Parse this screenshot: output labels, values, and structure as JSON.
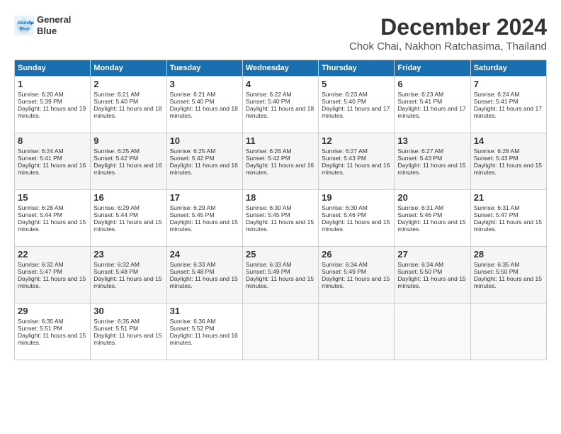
{
  "header": {
    "logo_line1": "General",
    "logo_line2": "Blue",
    "month": "December 2024",
    "location": "Chok Chai, Nakhon Ratchasima, Thailand"
  },
  "weekdays": [
    "Sunday",
    "Monday",
    "Tuesday",
    "Wednesday",
    "Thursday",
    "Friday",
    "Saturday"
  ],
  "weeks": [
    [
      {
        "day": "1",
        "sunrise": "6:20 AM",
        "sunset": "5:39 PM",
        "daylight": "11 hours and 19 minutes."
      },
      {
        "day": "2",
        "sunrise": "6:21 AM",
        "sunset": "5:40 PM",
        "daylight": "11 hours and 18 minutes."
      },
      {
        "day": "3",
        "sunrise": "6:21 AM",
        "sunset": "5:40 PM",
        "daylight": "11 hours and 18 minutes."
      },
      {
        "day": "4",
        "sunrise": "6:22 AM",
        "sunset": "5:40 PM",
        "daylight": "11 hours and 18 minutes."
      },
      {
        "day": "5",
        "sunrise": "6:23 AM",
        "sunset": "5:40 PM",
        "daylight": "11 hours and 17 minutes."
      },
      {
        "day": "6",
        "sunrise": "6:23 AM",
        "sunset": "5:41 PM",
        "daylight": "11 hours and 17 minutes."
      },
      {
        "day": "7",
        "sunrise": "6:24 AM",
        "sunset": "5:41 PM",
        "daylight": "11 hours and 17 minutes."
      }
    ],
    [
      {
        "day": "8",
        "sunrise": "6:24 AM",
        "sunset": "5:41 PM",
        "daylight": "11 hours and 16 minutes."
      },
      {
        "day": "9",
        "sunrise": "6:25 AM",
        "sunset": "5:42 PM",
        "daylight": "11 hours and 16 minutes."
      },
      {
        "day": "10",
        "sunrise": "6:25 AM",
        "sunset": "5:42 PM",
        "daylight": "11 hours and 16 minutes."
      },
      {
        "day": "11",
        "sunrise": "6:26 AM",
        "sunset": "5:42 PM",
        "daylight": "11 hours and 16 minutes."
      },
      {
        "day": "12",
        "sunrise": "6:27 AM",
        "sunset": "5:43 PM",
        "daylight": "11 hours and 16 minutes."
      },
      {
        "day": "13",
        "sunrise": "6:27 AM",
        "sunset": "5:43 PM",
        "daylight": "11 hours and 15 minutes."
      },
      {
        "day": "14",
        "sunrise": "6:28 AM",
        "sunset": "5:43 PM",
        "daylight": "11 hours and 15 minutes."
      }
    ],
    [
      {
        "day": "15",
        "sunrise": "6:28 AM",
        "sunset": "5:44 PM",
        "daylight": "11 hours and 15 minutes."
      },
      {
        "day": "16",
        "sunrise": "6:29 AM",
        "sunset": "5:44 PM",
        "daylight": "11 hours and 15 minutes."
      },
      {
        "day": "17",
        "sunrise": "6:29 AM",
        "sunset": "5:45 PM",
        "daylight": "11 hours and 15 minutes."
      },
      {
        "day": "18",
        "sunrise": "6:30 AM",
        "sunset": "5:45 PM",
        "daylight": "11 hours and 15 minutes."
      },
      {
        "day": "19",
        "sunrise": "6:30 AM",
        "sunset": "5:46 PM",
        "daylight": "11 hours and 15 minutes."
      },
      {
        "day": "20",
        "sunrise": "6:31 AM",
        "sunset": "5:46 PM",
        "daylight": "11 hours and 15 minutes."
      },
      {
        "day": "21",
        "sunrise": "6:31 AM",
        "sunset": "5:47 PM",
        "daylight": "11 hours and 15 minutes."
      }
    ],
    [
      {
        "day": "22",
        "sunrise": "6:32 AM",
        "sunset": "5:47 PM",
        "daylight": "11 hours and 15 minutes."
      },
      {
        "day": "23",
        "sunrise": "6:32 AM",
        "sunset": "5:48 PM",
        "daylight": "11 hours and 15 minutes."
      },
      {
        "day": "24",
        "sunrise": "6:33 AM",
        "sunset": "5:48 PM",
        "daylight": "11 hours and 15 minutes."
      },
      {
        "day": "25",
        "sunrise": "6:33 AM",
        "sunset": "5:49 PM",
        "daylight": "11 hours and 15 minutes."
      },
      {
        "day": "26",
        "sunrise": "6:34 AM",
        "sunset": "5:49 PM",
        "daylight": "11 hours and 15 minutes."
      },
      {
        "day": "27",
        "sunrise": "6:34 AM",
        "sunset": "5:50 PM",
        "daylight": "11 hours and 15 minutes."
      },
      {
        "day": "28",
        "sunrise": "6:35 AM",
        "sunset": "5:50 PM",
        "daylight": "11 hours and 15 minutes."
      }
    ],
    [
      {
        "day": "29",
        "sunrise": "6:35 AM",
        "sunset": "5:51 PM",
        "daylight": "11 hours and 15 minutes."
      },
      {
        "day": "30",
        "sunrise": "6:35 AM",
        "sunset": "5:51 PM",
        "daylight": "11 hours and 15 minutes."
      },
      {
        "day": "31",
        "sunrise": "6:36 AM",
        "sunset": "5:52 PM",
        "daylight": "11 hours and 16 minutes."
      },
      null,
      null,
      null,
      null
    ]
  ]
}
